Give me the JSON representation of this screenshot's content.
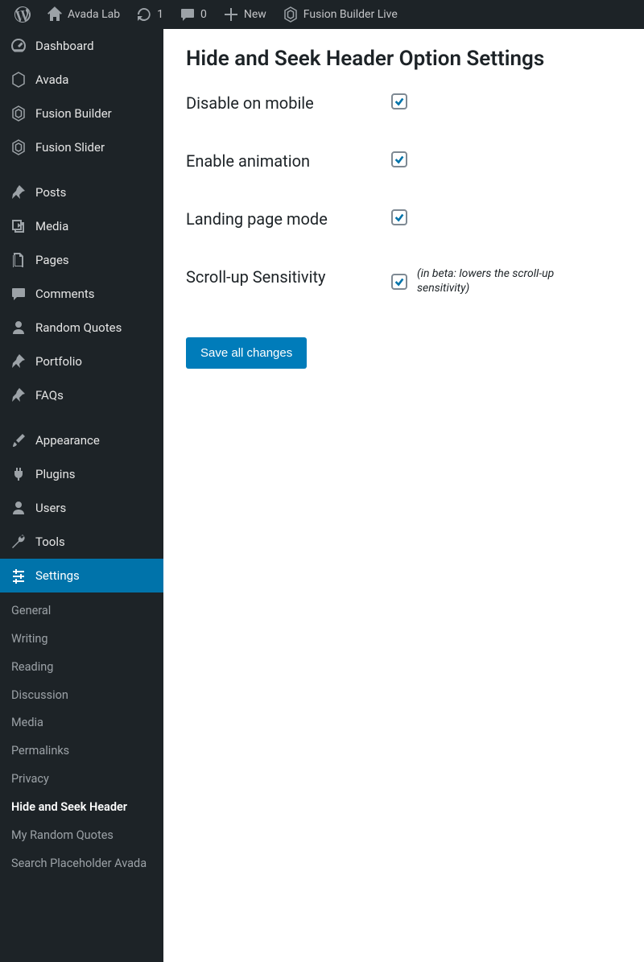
{
  "adminBar": {
    "siteName": "Avada Lab",
    "updatesCount": "1",
    "commentsCount": "0",
    "newLabel": "New",
    "fusionBuilderLive": "Fusion Builder Live"
  },
  "sidebar": {
    "dashboard": "Dashboard",
    "avada": "Avada",
    "fusionBuilder": "Fusion Builder",
    "fusionSlider": "Fusion Slider",
    "posts": "Posts",
    "media": "Media",
    "pages": "Pages",
    "comments": "Comments",
    "randomQuotes": "Random Quotes",
    "portfolio": "Portfolio",
    "faqs": "FAQs",
    "appearance": "Appearance",
    "plugins": "Plugins",
    "users": "Users",
    "tools": "Tools",
    "settings": "Settings"
  },
  "submenu": {
    "general": "General",
    "writing": "Writing",
    "reading": "Reading",
    "discussion": "Discussion",
    "media": "Media",
    "permalinks": "Permalinks",
    "privacy": "Privacy",
    "hideAndSeek": "Hide and Seek Header",
    "myRandomQuotes": "My Random Quotes",
    "searchPlaceholder": "Search Placeholder Avada"
  },
  "page": {
    "title": "Hide and Seek Header Option Settings",
    "options": {
      "disableMobile": {
        "label": "Disable on mobile",
        "checked": true
      },
      "enableAnimation": {
        "label": "Enable animation",
        "checked": true
      },
      "landingPageMode": {
        "label": "Landing page mode",
        "checked": true
      },
      "scrollUpSensitivity": {
        "label": "Scroll-up Sensitivity",
        "checked": true,
        "note": "(in beta: lowers the scroll-up sensitivity)"
      }
    },
    "saveButton": "Save all changes"
  }
}
